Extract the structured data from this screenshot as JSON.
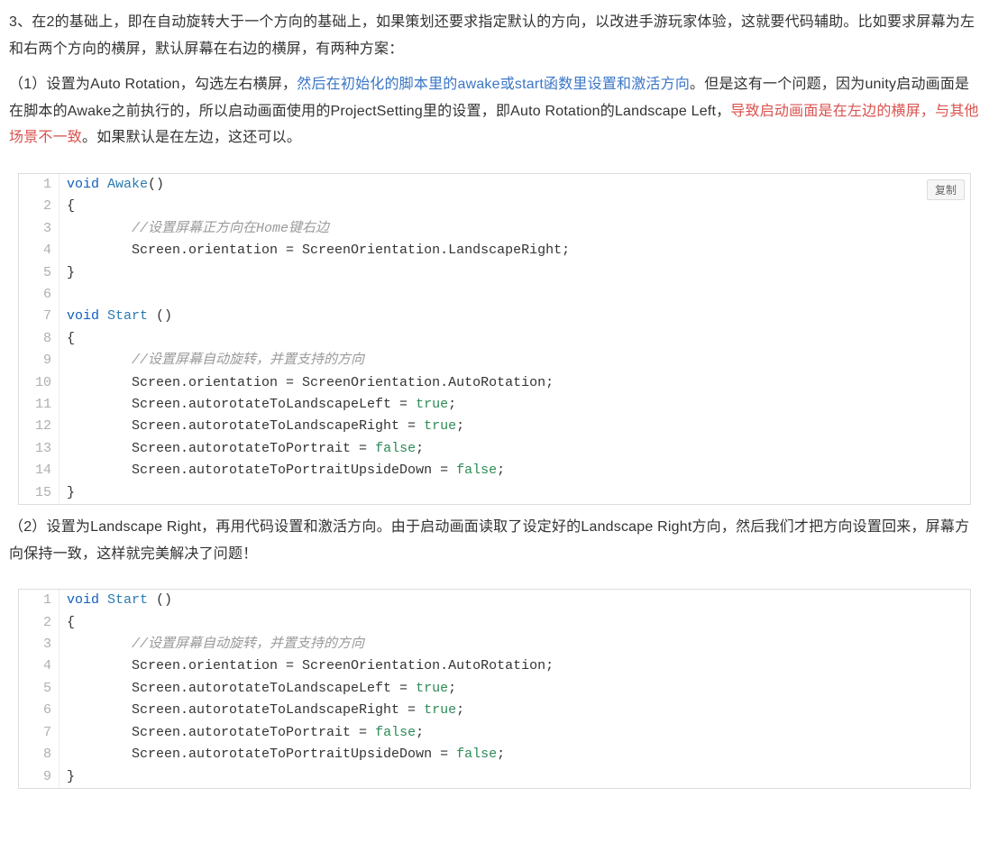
{
  "paragraphs": {
    "p1": "3、在2的基础上，即在自动旋转大于一个方向的基础上，如果策划还要求指定默认的方向，以改进手游玩家体验，这就要代码辅助。比如要求屏幕为左和右两个方向的横屏，默认屏幕在右边的横屏，有两种方案：",
    "p2_prefix": "（1）设置为Auto Rotation，勾选左右横屏，",
    "p2_blue": "然后在初始化的脚本里的awake或start函数里设置和激活方向",
    "p2_mid": "。但是这有一个问题，因为unity启动画面是在脚本的Awake之前执行的，所以启动画面使用的ProjectSetting里的设置，即Auto Rotation的Landscape Left，",
    "p2_red": "导致启动画面是在左边的横屏，与其他场景不一致",
    "p2_suffix": "。如果默认是在左边，这还可以。",
    "p3": "（2）设置为Landscape Right，再用代码设置和激活方向。由于启动画面读取了设定好的Landscape Right方向，然后我们才把方向设置回来，屏幕方向保持一致，这样就完美解决了问题！"
  },
  "ui": {
    "copy_label": "复制"
  },
  "code1": [
    [
      {
        "t": "void ",
        "c": "kw"
      },
      {
        "t": "Awake",
        "c": "fn"
      },
      {
        "t": "()",
        "c": "plain"
      }
    ],
    [
      {
        "t": "{",
        "c": "plain"
      }
    ],
    [
      {
        "t": "        ",
        "c": "plain"
      },
      {
        "t": "//设置屏幕正方向在Home键右边",
        "c": "cmt"
      }
    ],
    [
      {
        "t": "        Screen.orientation = ScreenOrientation.LandscapeRight;",
        "c": "plain"
      }
    ],
    [
      {
        "t": "}",
        "c": "plain"
      }
    ],
    [
      {
        "t": "",
        "c": "plain"
      }
    ],
    [
      {
        "t": "void ",
        "c": "kw"
      },
      {
        "t": "Start",
        "c": "fn"
      },
      {
        "t": " ()",
        "c": "plain"
      }
    ],
    [
      {
        "t": "{",
        "c": "plain"
      }
    ],
    [
      {
        "t": "        ",
        "c": "plain"
      },
      {
        "t": "//设置屏幕自动旋转，并置支持的方向",
        "c": "cmt"
      }
    ],
    [
      {
        "t": "        Screen.orientation = ScreenOrientation.AutoRotation;",
        "c": "plain"
      }
    ],
    [
      {
        "t": "        Screen.autorotateToLandscapeLeft = ",
        "c": "plain"
      },
      {
        "t": "true",
        "c": "bool"
      },
      {
        "t": ";",
        "c": "plain"
      }
    ],
    [
      {
        "t": "        Screen.autorotateToLandscapeRight = ",
        "c": "plain"
      },
      {
        "t": "true",
        "c": "bool"
      },
      {
        "t": ";",
        "c": "plain"
      }
    ],
    [
      {
        "t": "        Screen.autorotateToPortrait = ",
        "c": "plain"
      },
      {
        "t": "false",
        "c": "bool"
      },
      {
        "t": ";",
        "c": "plain"
      }
    ],
    [
      {
        "t": "        Screen.autorotateToPortraitUpsideDown = ",
        "c": "plain"
      },
      {
        "t": "false",
        "c": "bool"
      },
      {
        "t": ";",
        "c": "plain"
      }
    ],
    [
      {
        "t": "}",
        "c": "plain"
      }
    ]
  ],
  "code2": [
    [
      {
        "t": "void ",
        "c": "kw"
      },
      {
        "t": "Start",
        "c": "fn"
      },
      {
        "t": " ()",
        "c": "plain"
      }
    ],
    [
      {
        "t": "{",
        "c": "plain"
      }
    ],
    [
      {
        "t": "        ",
        "c": "plain"
      },
      {
        "t": "//设置屏幕自动旋转，并置支持的方向",
        "c": "cmt"
      }
    ],
    [
      {
        "t": "        Screen.orientation = ScreenOrientation.AutoRotation;",
        "c": "plain"
      }
    ],
    [
      {
        "t": "        Screen.autorotateToLandscapeLeft = ",
        "c": "plain"
      },
      {
        "t": "true",
        "c": "bool"
      },
      {
        "t": ";",
        "c": "plain"
      }
    ],
    [
      {
        "t": "        Screen.autorotateToLandscapeRight = ",
        "c": "plain"
      },
      {
        "t": "true",
        "c": "bool"
      },
      {
        "t": ";",
        "c": "plain"
      }
    ],
    [
      {
        "t": "        Screen.autorotateToPortrait = ",
        "c": "plain"
      },
      {
        "t": "false",
        "c": "bool"
      },
      {
        "t": ";",
        "c": "plain"
      }
    ],
    [
      {
        "t": "        Screen.autorotateToPortraitUpsideDown = ",
        "c": "plain"
      },
      {
        "t": "false",
        "c": "bool"
      },
      {
        "t": ";",
        "c": "plain"
      }
    ],
    [
      {
        "t": "}",
        "c": "plain"
      }
    ]
  ]
}
